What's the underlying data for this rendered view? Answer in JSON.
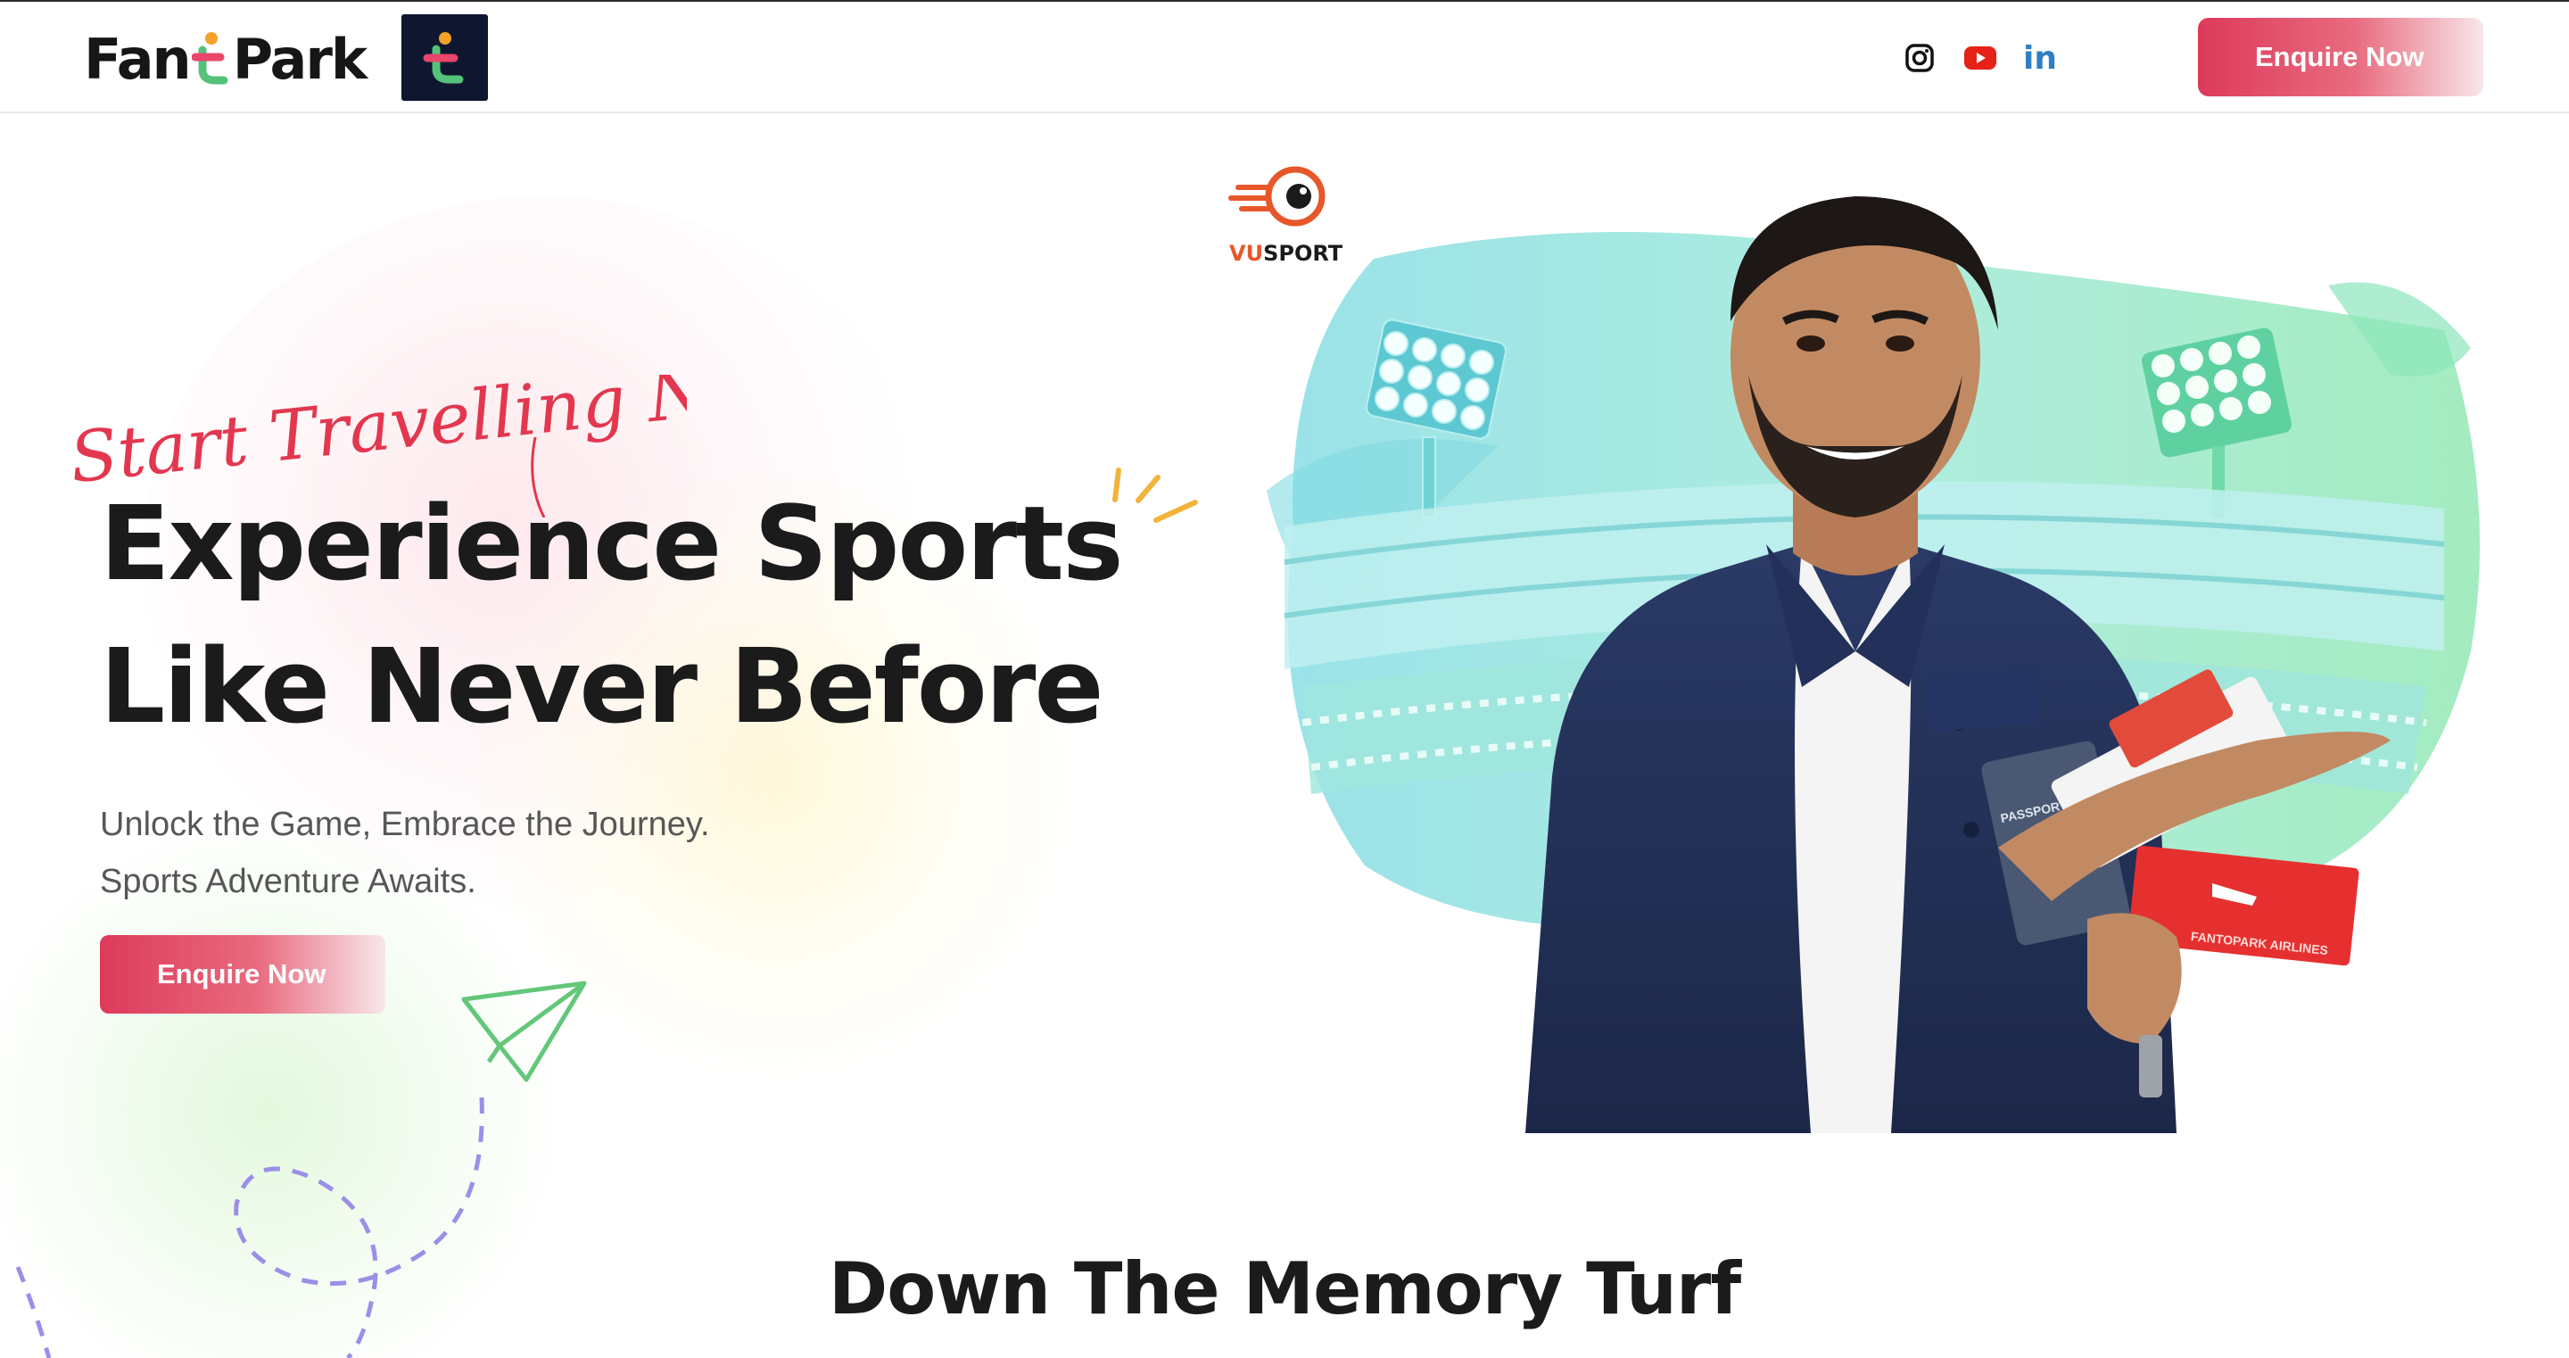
{
  "header": {
    "brand_text_left": "Fan",
    "brand_text_right": "Park",
    "social_links": [
      {
        "name": "instagram-icon",
        "color": "#111111"
      },
      {
        "name": "youtube-icon",
        "color": "#e62117"
      },
      {
        "name": "linkedin-icon",
        "label": "in",
        "color": "#2f7fc1"
      }
    ],
    "enquire_label": "Enquire Now"
  },
  "hero": {
    "script_text": "Start Travelling Now",
    "title_line1": "Experience Sports",
    "title_line2": "Like Never Before",
    "subtitle_line1": "Unlock the Game, Embrace the Journey.",
    "subtitle_line2": "Sports Adventure Awaits.",
    "cta_label": "Enquire Now",
    "partner_logo": {
      "part1": "VU",
      "part2": "SPORT"
    },
    "ticket_text": "FANTOPARK AIRLINES",
    "passport_text": "PASSPORT"
  },
  "section": {
    "title": "Down The Memory Turf"
  },
  "colors": {
    "accent": "#dd3a5a",
    "teal": "#6fd8d4",
    "green": "#7ee0a8",
    "vusport_orange": "#e7572a"
  }
}
